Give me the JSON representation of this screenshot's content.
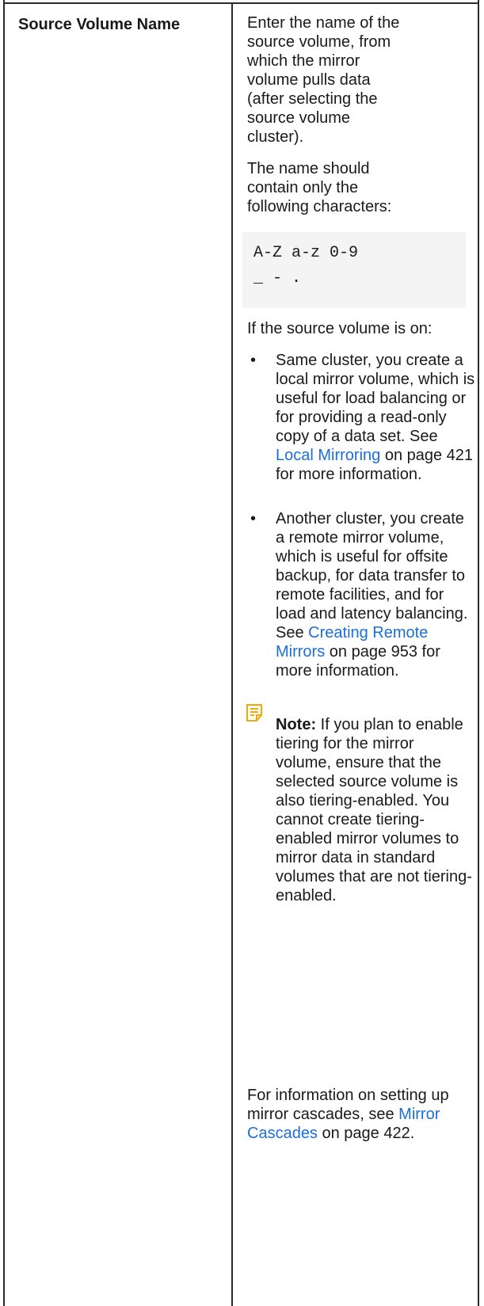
{
  "row": {
    "field_name": "Source Volume Name",
    "description_1": "Enter the name of the source volume, from which the mirror volume pulls data (after selecting the source volume cluster).",
    "description_2": "The name should contain only the following characters:",
    "code_line_1": "A-Z a-z 0-9",
    "code_line_2": "_ - .",
    "description_3": "If the source volume is on:",
    "bullet_1": {
      "text_before": "Same cluster, you create a local mirror volume, which is useful for load balancing or for providing a read-only copy of a data set. See ",
      "link": "Local Mirroring",
      "text_after": " on page 421 for more information."
    },
    "bullet_2": {
      "text_before": "Another cluster, you create a remote mirror volume, which is useful for offsite backup, for data transfer to remote facilities, and for load and latency balancing. See ",
      "link": "Creating Remote Mirrors",
      "text_after": " on page 953 for more information."
    },
    "note": {
      "label": "Note:",
      "text": " If you plan to enable tiering for the mirror volume, ensure that the selected source volume is also tiering-enabled. You cannot create tiering-enabled mirror volumes to mirror data in standard volumes that are not tiering-enabled.",
      "icon": "note-icon"
    },
    "description_4": {
      "text_before": "For information on setting up mirror cascades, see ",
      "link": "Mirror Cascades",
      "text_after": " on page 422."
    }
  },
  "colors": {
    "link": "#1a6fd9",
    "note_icon": "#f2a900",
    "code_bg": "#f4f4f4"
  }
}
